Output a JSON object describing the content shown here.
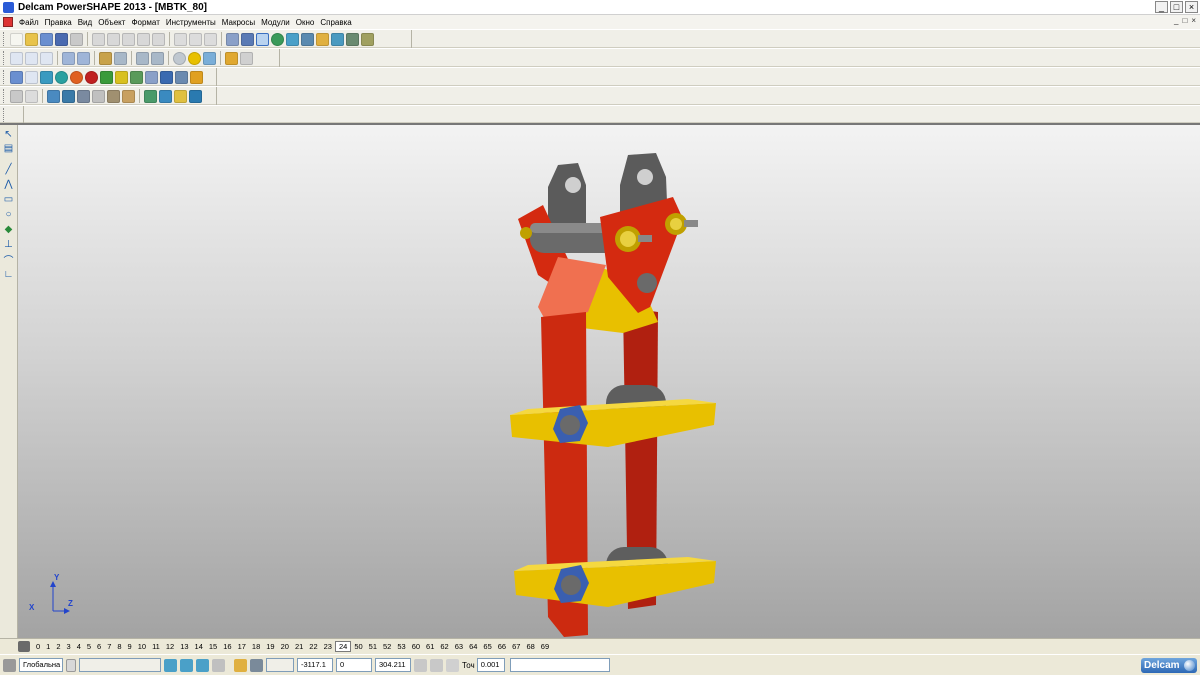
{
  "window": {
    "title": "Delcam PowerSHAPE 2013 - [MBTK_80]",
    "buttons": [
      "_",
      "□",
      "×"
    ]
  },
  "menu": {
    "items": [
      "Файл",
      "Правка",
      "Вид",
      "Объект",
      "Формат",
      "Инструменты",
      "Макросы",
      "Модули",
      "Окно",
      "Справка"
    ],
    "mdi_buttons": [
      "_",
      "□",
      "×"
    ]
  },
  "colors": {
    "viewport_top": "#f3f3f3",
    "viewport_bottom": "#a3a3a3",
    "frame_red": "#d42a10",
    "plate_yellow": "#e8c000",
    "bracket_gray": "#595959",
    "nut_blue": "#3a5fb0"
  },
  "left_tools": [
    "select-icon",
    "layers-icon",
    "line-icon",
    "polyline-icon",
    "rectangle-icon",
    "circle-icon",
    "solid-icon",
    "dimension-icon",
    "arc-icon",
    "workplane-icon"
  ],
  "triad": {
    "y": "Y",
    "x": "X",
    "z": "Z"
  },
  "levels": {
    "items": [
      "0",
      "1",
      "2",
      "3",
      "4",
      "5",
      "6",
      "7",
      "8",
      "9",
      "10",
      "11",
      "12",
      "13",
      "14",
      "15",
      "16",
      "17",
      "18",
      "19",
      "20",
      "21",
      "22",
      "23",
      "24",
      "50",
      "51",
      "52",
      "53",
      "60",
      "61",
      "62",
      "63",
      "64",
      "65",
      "66",
      "67",
      "68",
      "69"
    ],
    "active": "24"
  },
  "status": {
    "workplane": "Глобальна",
    "coord_x": "-3117.1",
    "coord_y": "0",
    "coord_z": "304.211",
    "tolerance_label": "Точ",
    "tolerance_value": "0.001"
  },
  "logo": {
    "text": "Delcam"
  }
}
